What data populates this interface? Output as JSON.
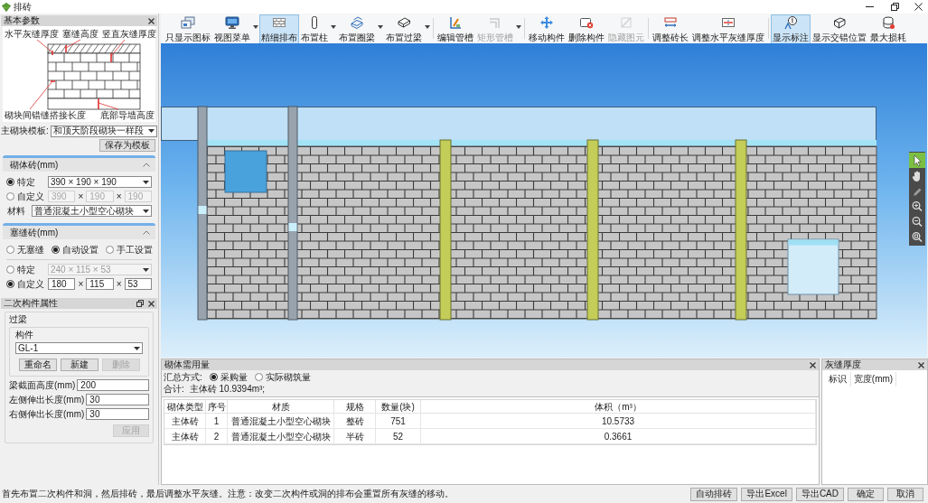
{
  "window": {
    "title": "排砖"
  },
  "basic_params": {
    "title": "基本参数",
    "diagram_labels": [
      "水平灰缝厚度",
      "塞缝高度",
      "竖直灰缝厚度",
      "砌块间错缝搭接长度",
      "底部导墙高度"
    ],
    "template_label": "主砌块模板:",
    "template": "和顶天阶段砌块一样段",
    "save_button": "保存为模板"
  },
  "block": {
    "title": "砌体砖(mm)",
    "options": [
      {
        "label": "特定",
        "selected": true,
        "kind": "select",
        "value": "390 × 190 × 190"
      },
      {
        "label": "自定义",
        "selected": false,
        "kind": "dims",
        "values": [
          "390",
          "190",
          "190"
        ],
        "separators": [
          "×",
          "×"
        ]
      }
    ],
    "material_label": "材料",
    "material": "普通混凝土小型空心砌块"
  },
  "filler": {
    "title": "塞缝砖(mm)",
    "modes": [
      {
        "label": "无塞缝",
        "selected": false
      },
      {
        "label": "自动设置",
        "selected": true
      },
      {
        "label": "手工设置",
        "selected": false
      }
    ],
    "options": [
      {
        "label": "特定",
        "selected": false,
        "kind": "select",
        "value": "240 × 115 × 53"
      },
      {
        "label": "自定义",
        "selected": true,
        "kind": "dims",
        "values": [
          "180",
          "115",
          "53"
        ],
        "separators": [
          "×",
          "×"
        ]
      }
    ]
  },
  "secondary": {
    "title": "二次构件属性",
    "group_title": "过梁",
    "component_title": "构件",
    "component": "GL-1",
    "buttons": [
      {
        "label": "重命名",
        "disabled": false
      },
      {
        "label": "新建",
        "disabled": false
      },
      {
        "label": "删除",
        "disabled": true
      }
    ],
    "fields": [
      {
        "label": "梁截面高度(mm)",
        "value": "200"
      },
      {
        "label": "左侧伸出长度(mm)",
        "value": "30"
      },
      {
        "label": "右侧伸出长度(mm)",
        "value": "30"
      }
    ],
    "apply": {
      "label": "应用",
      "disabled": true
    }
  },
  "toolbar": {
    "groups": [
      [
        {
          "label": "只显示图标",
          "selected": false,
          "disabled": false,
          "dropdown": false
        },
        {
          "label": "视图菜单",
          "selected": false,
          "disabled": false,
          "dropdown": true
        },
        {
          "label": "精细排布",
          "selected": true,
          "disabled": false,
          "dropdown": false
        },
        {
          "label": "布置柱",
          "selected": false,
          "disabled": false,
          "dropdown": true
        },
        {
          "label": "布置圈梁",
          "selected": false,
          "disabled": false,
          "dropdown": true
        },
        {
          "label": "布置过梁",
          "selected": false,
          "disabled": false,
          "dropdown": true
        }
      ],
      [
        {
          "label": "编辑管槽",
          "selected": false,
          "disabled": false,
          "dropdown": false
        },
        {
          "label": "矩形管槽",
          "selected": false,
          "disabled": true,
          "dropdown": true
        }
      ],
      [
        {
          "label": "移动构件",
          "selected": false,
          "disabled": false,
          "dropdown": false
        },
        {
          "label": "删除构件",
          "selected": false,
          "disabled": false,
          "dropdown": false
        },
        {
          "label": "隐藏图元",
          "selected": false,
          "disabled": true,
          "dropdown": false
        }
      ],
      [
        {
          "label": "调整砖长",
          "selected": false,
          "disabled": false,
          "dropdown": false
        },
        {
          "label": "调整水平灰缝厚度",
          "selected": false,
          "disabled": false,
          "dropdown": false
        }
      ],
      [
        {
          "label": "显示标注",
          "selected": true,
          "disabled": false,
          "dropdown": false
        },
        {
          "label": "显示交错位置",
          "selected": false,
          "disabled": false,
          "dropdown": false
        },
        {
          "label": "最大损耗",
          "selected": false,
          "disabled": false,
          "dropdown": false
        }
      ]
    ]
  },
  "view_tools": [
    {
      "selected": true
    },
    {
      "selected": false
    },
    {
      "selected": false
    },
    {
      "selected": false
    },
    {
      "selected": false
    },
    {
      "selected": false
    }
  ],
  "usage": {
    "title": "砌体需用量",
    "mode_label": "汇总方式:",
    "modes": [
      {
        "label": "采购量",
        "selected": true
      },
      {
        "label": "实际砌筑量",
        "selected": false
      }
    ],
    "total_label": "合计:",
    "total": "主体砖 10.9394m³;",
    "columns": [
      "砌体类型",
      "序号",
      "材质",
      "规格",
      "数量(块)",
      "体积（m³）"
    ],
    "rows": [
      [
        "主体砖",
        "1",
        "普通混凝土小型空心砌块",
        "整砖",
        "751",
        "10.5733"
      ],
      [
        "主体砖",
        "2",
        "普通混凝土小型空心砌块",
        "半砖",
        "52",
        "0.3661"
      ]
    ]
  },
  "joints": {
    "title": "灰缝厚度",
    "columns": [
      "标识",
      "宽度(mm)"
    ]
  },
  "status_bar": {
    "message": "首先布置二次构件和洞，然后排砖，最后调整水平灰缝。注意：改变二次构件或洞的排布会重置所有灰缝的移动。",
    "buttons": [
      "自动排砖",
      "导出Excel",
      "导出CAD",
      "确定",
      "取消"
    ]
  }
}
